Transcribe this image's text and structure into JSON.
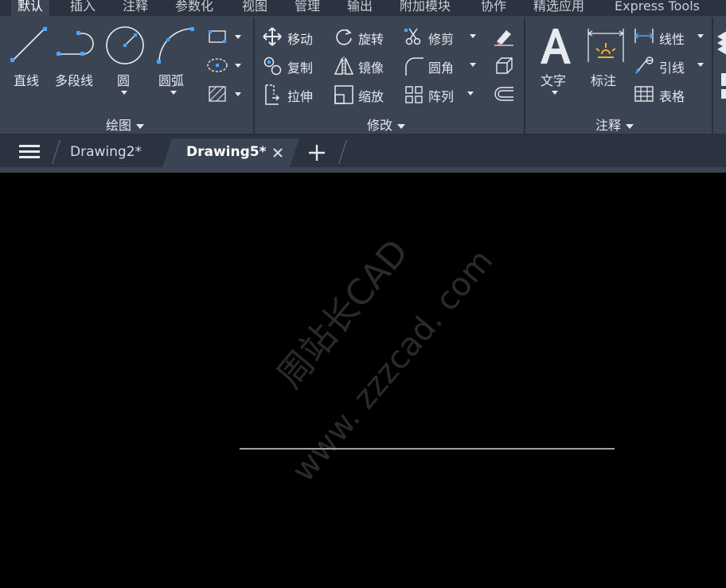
{
  "ribbon_tabs": [
    "默认",
    "插入",
    "注释",
    "参数化",
    "视图",
    "管理",
    "输出",
    "附加模块",
    "协作",
    "精选应用",
    "Express Tools"
  ],
  "draw_panel": {
    "title": "绘图",
    "line": "直线",
    "polyline": "多段线",
    "circle": "圆",
    "arc": "圆弧"
  },
  "modify_panel": {
    "title": "修改",
    "move": "移动",
    "rotate": "旋转",
    "trim": "修剪",
    "copy": "复制",
    "mirror": "镜像",
    "fillet": "圆角",
    "stretch": "拉伸",
    "scale": "缩放",
    "array": "阵列"
  },
  "annotation_panel": {
    "title": "注释",
    "text": "文字",
    "dimension": "标注",
    "linear": "线性",
    "leader": "引线",
    "table": "表格"
  },
  "doc_tabs": {
    "drawing2": "Drawing2*",
    "drawing5": "Drawing5*"
  },
  "watermark": {
    "text1": "周站长CAD",
    "text2": "www. zzzcad. com"
  }
}
